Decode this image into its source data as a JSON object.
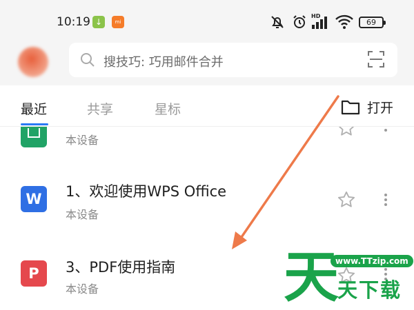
{
  "status_bar": {
    "time": "10:19",
    "notification_icons": [
      "download-icon",
      "app-icon"
    ],
    "app_icon_text": "mi",
    "hd_label": "HD",
    "battery": "69"
  },
  "header": {
    "search_placeholder": "搜技巧: 巧用邮件合并"
  },
  "tabs": [
    {
      "label": "最近",
      "active": true
    },
    {
      "label": "共享",
      "active": false
    },
    {
      "label": "星标",
      "active": false
    }
  ],
  "open_button_label": "打开",
  "files": [
    {
      "name": "",
      "location": "本设备",
      "type": "sheet",
      "icon_color": "#21a366"
    },
    {
      "name": "1、欢迎使用WPS Office",
      "location": "本设备",
      "type": "word",
      "icon_color": "#2f6fe4",
      "icon_letter": "W"
    },
    {
      "name": "3、PDF使用指南",
      "location": "本设备",
      "type": "pdf",
      "icon_color": "#e5484d",
      "icon_letter": "P"
    }
  ],
  "watermark": {
    "big_char": "天",
    "url": "www.TTzip.com",
    "text": "天下载"
  },
  "colors": {
    "accent": "#2a7af5",
    "arrow": "#ee7a4a",
    "watermark_green": "#1aa34a"
  }
}
